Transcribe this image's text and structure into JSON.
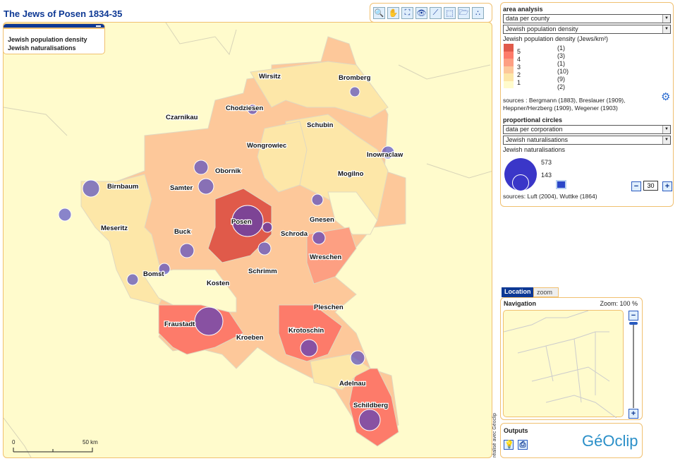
{
  "title": "The Jews of Posen 1834-35",
  "toolbar": {
    "tools": [
      {
        "name": "zoom-tool-icon",
        "glyph": "🔍"
      },
      {
        "name": "pan-hand-icon",
        "glyph": "✋"
      },
      {
        "name": "full-extent-icon",
        "glyph": "⛶"
      },
      {
        "name": "binoculars-icon",
        "glyph": "👁"
      },
      {
        "name": "measure-icon",
        "glyph": "⟋"
      },
      {
        "name": "select-area-icon",
        "glyph": "⬚"
      },
      {
        "name": "open-folder-icon",
        "glyph": "🗁"
      },
      {
        "name": "points-toggle-icon",
        "glyph": "∴"
      }
    ]
  },
  "layers": {
    "items": [
      "Jewish population density",
      "Jewish naturalisations"
    ]
  },
  "area_analysis": {
    "heading": "area analysis",
    "level_select": "data per county",
    "variable_select": "Jewish population density",
    "legend_title": "Jewish population density (Jews/km²)",
    "classes": [
      {
        "color": "#e05a4a",
        "count": "(1)"
      },
      {
        "color": "#fd7b6a",
        "count": "(3)"
      },
      {
        "color": "#fd9f82",
        "count": "(1)"
      },
      {
        "color": "#fdc89a",
        "count": "(10)"
      },
      {
        "color": "#fde7a8",
        "count": "(9)"
      },
      {
        "color": "#fffbcc",
        "count": "(2)"
      }
    ],
    "breaks": [
      "5",
      "4",
      "3",
      "2",
      "1"
    ],
    "sources": "sources : Bergmann (1883), Breslauer (1909), Heppner/Herzberg (1909), Wegener (1903)"
  },
  "circles": {
    "heading": "proportional circles",
    "level_select": "data per corporation",
    "variable_select": "Jewish naturalisations",
    "legend_title": "Jewish naturalisations",
    "max_value": "573",
    "min_value": "143",
    "size_value": "30",
    "color": "#3a36c8",
    "sources": "sources: Luft (2004), Wuttke (1864)"
  },
  "scale": {
    "start": "0",
    "end": "50 km"
  },
  "map_labels": [
    "Wirsitz",
    "Bromberg",
    "Chodziesen",
    "Czarnikau",
    "Schubin",
    "Wongrowiec",
    "Inowraclaw",
    "Obornik",
    "Mogilno",
    "Birnbaum",
    "Samter",
    "Gnesen",
    "Meseritz",
    "Posen",
    "Schroda",
    "Buck",
    "Wreschen",
    "Bomst",
    "Schrimm",
    "Kosten",
    "Pleschen",
    "Fraustadt",
    "Krotoschin",
    "Kroeben",
    "Adelnau",
    "Schildberg"
  ],
  "navigation": {
    "tab_location": "Location",
    "tab_zoom": "zoom",
    "title": "Navigation",
    "zoom_label": "Zoom: 100 %"
  },
  "outputs": {
    "title": "Outputs",
    "logo": "GéOclip"
  },
  "credit": "réalisé avec Géoclip"
}
